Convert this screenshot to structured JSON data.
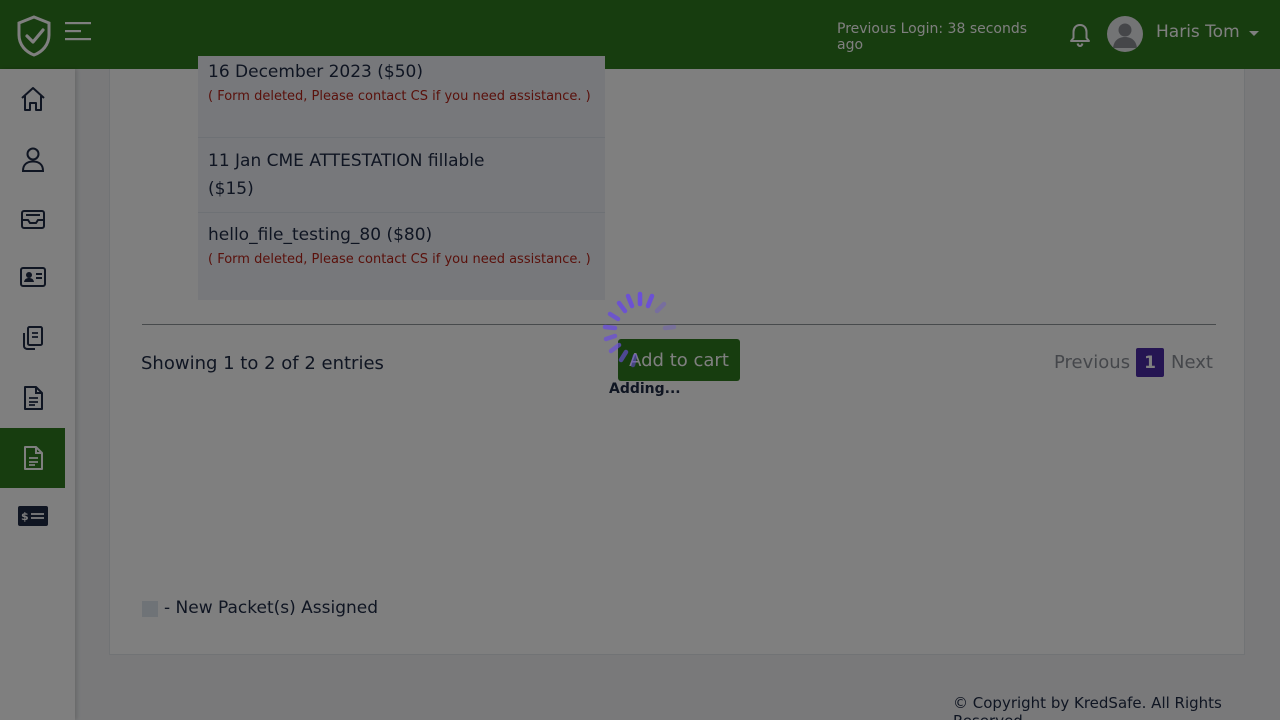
{
  "header": {
    "previous_login": "Previous Login: 38 seconds ago",
    "user_name": "Haris Tom",
    "brand_color": "#2f7a1f"
  },
  "sidebar": {
    "items": [
      {
        "icon": "home-icon"
      },
      {
        "icon": "user-icon"
      },
      {
        "icon": "inbox-icon"
      },
      {
        "icon": "id-card-icon"
      },
      {
        "icon": "documents-hand-icon"
      },
      {
        "icon": "document-icon"
      },
      {
        "icon": "document-active-icon",
        "active": true
      },
      {
        "icon": "billing-card-icon"
      }
    ]
  },
  "packets": [
    {
      "title": "16 December 2023 ($50)",
      "note": "( Form deleted, Please contact CS if you need assistance. )"
    },
    {
      "title": "11 Jan CME ATTESTATION fillable ($15)",
      "note": ""
    },
    {
      "title": "hello_file_testing_80 ($80)",
      "note": "( Form deleted, Please contact CS if you need assistance. )"
    }
  ],
  "table_info": "Showing 1 to 2 of 2 entries",
  "actions": {
    "add_to_cart": "Add to cart",
    "adding": "Adding..."
  },
  "pagination": {
    "previous": "Previous",
    "current": "1",
    "next": "Next"
  },
  "legend": "- New Packet(s) Assigned",
  "footer": "© Copyright by KredSafe. All Rights Reserved."
}
